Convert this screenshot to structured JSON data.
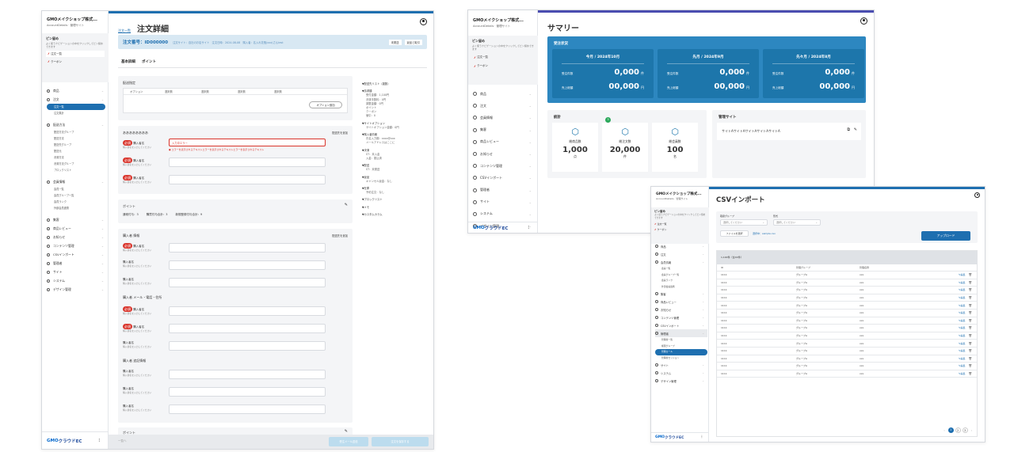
{
  "shared": {
    "brand": "GMOメイクショップ株式...",
    "account": "AccountDetails · 管理サイト",
    "pin_title": "ピン留め",
    "pin_desc": "よく使うナビゲーションの中をクリックしてピン留めできます",
    "pinned": [
      "注文一覧",
      "クーポン"
    ],
    "gmo_logo": "GMO",
    "gmo_logo_rest": "クラウドEC"
  },
  "win1": {
    "breadcrumb": "注文一覧",
    "title": "注文詳細",
    "order_bar": {
      "number": "注文番号：ID000000",
      "meta": "注文サイト：自社のお店サイト　注文日時：2024-08-08　購入者：名入れ花瓶(xxx)さんtest",
      "badges": [
        "未発送",
        "返品と取引"
      ]
    },
    "tabs": [
      "基本詳細",
      "ポイント"
    ],
    "nav": [
      {
        "label": "商品",
        "subs": []
      },
      {
        "label": "注文",
        "subs": [
          "注文一覧",
          "注文集計"
        ]
      },
      {
        "label": "配送方法",
        "subs": [
          "配送方法グループ",
          "配送方法",
          "配送先グループ"
        ]
      },
      {
        "label": "",
        "subs": [
          "配送元",
          "決済方法",
          "決済方法グループ",
          "ブロックリスト"
        ]
      },
      {
        "label": "会員情報",
        "subs": [
          "会員一覧",
          "会員グループ一覧",
          "会員ランク",
          "外部会員連携"
        ]
      },
      {
        "label": "集客",
        "subs": []
      },
      {
        "label": "商品レビュー",
        "subs": []
      },
      {
        "label": "お知らせ",
        "subs": []
      },
      {
        "label": "コンテンツ管理",
        "subs": []
      },
      {
        "label": "CSVインポート",
        "subs": []
      },
      {
        "label": "管理者",
        "subs": []
      },
      {
        "label": "サイト",
        "subs": []
      },
      {
        "label": "システム",
        "subs": []
      },
      {
        "label": "デザイン管理",
        "subs": []
      }
    ],
    "option_section": {
      "title": "配送指定",
      "col_headers": [
        "オプション",
        "選択肢",
        "選択肢",
        "選択肢",
        "選択肢"
      ],
      "button": "オプション追加"
    },
    "purchaser_section": {
      "title": "ああああああああ",
      "link": "配送先を追加",
      "field_label": "購入者名",
      "field_hint": "購入者名を入力してください",
      "error_value": "入力中エラー",
      "error_msg": "エラーを表示されるテキストエラーを表示されるテキストエラーを表示されるテキスト"
    },
    "point_section": {
      "title": "ポイント",
      "items": [
        "通常付与：3",
        "購買付与合計：3",
        "新規登録付与合計：9"
      ]
    },
    "addr_section": {
      "title": "購入者 情報",
      "link": "配送先を追加",
      "sub_title": "購入者 メール・電話・住所",
      "sub_title2": "購入者 追記情報"
    },
    "point_footer": "ポイント",
    "side_notes": [
      "▼配送先リスト（複数）",
      "▼請求額",
      "受付金額：1,100円",
      "決済手数料：0円",
      "調整金額：0円",
      "ポイント",
      "クーポン",
      "値引：0",
      "▼サイトオプション",
      "サイトオプション金額：0円",
      "▼購入者情報",
      "氏名入力欄：xxxx@xxx",
      "メールアドレスはここに",
      "▼決済",
      "ST：未入金",
      "入金：振込済",
      "▼配送",
      "ST：未発送",
      "▼返品",
      "キャンセル返金：なし",
      "▼在庫",
      "予約注文：なし",
      "▼ブロックリスト",
      "▼メモ",
      "▼カスタムカラム"
    ],
    "footer_buttons": [
      "一覧へ",
      "受注メール送信",
      "注文を保存する"
    ]
  },
  "win2": {
    "title": "サマリー",
    "status_title": "受注状況",
    "months": [
      {
        "label": "今月 / 2024年10月",
        "orders_label": "受注件数",
        "orders": "0,000",
        "orders_unit": "件",
        "sales_label": "売上総額",
        "sales": "00,000",
        "sales_unit": "円"
      },
      {
        "label": "先月 / 2024年9月",
        "orders_label": "受注件数",
        "orders": "0,000",
        "orders_unit": "件",
        "sales_label": "売上総額",
        "sales": "00,000",
        "sales_unit": "円"
      },
      {
        "label": "先々月 / 2024年8月",
        "orders_label": "受注件数",
        "orders": "0,000",
        "orders_unit": "件",
        "sales_label": "売上総額",
        "sales": "00,000",
        "sales_unit": "円"
      }
    ],
    "stats_title": "統計",
    "stats_badge": "3",
    "stats": [
      {
        "label": "総商品数",
        "value": "1,000",
        "unit": "点"
      },
      {
        "label": "総注文数",
        "value": "20,000",
        "unit": "件"
      },
      {
        "label": "総会員数",
        "value": "100",
        "unit": "名"
      }
    ],
    "admin_title": "管理サイト",
    "admin_site": "サイトAサイトAサイトAサイトAサイトA",
    "nav": [
      "商品",
      "注文",
      "会員情報",
      "集客",
      "商品レビュー",
      "お知らせ",
      "コンテンツ管理",
      "CSVインポート",
      "管理者",
      "サイト",
      "システム",
      "デザイン管理"
    ]
  },
  "win3": {
    "title": "CSVインポート",
    "filter_labels": [
      "取扱グループ",
      "形式"
    ],
    "select_placeholder": "選択してください",
    "file_button": "ファイルを選択",
    "file_name": "選択中：sample.csv",
    "upload_button": "アップロード",
    "list_title": "1,100件（全XX件）",
    "columns": [
      "ID",
      "管理グループ",
      "管理名称"
    ],
    "rows": [
      [
        "1111",
        "グループA",
        "xxx"
      ],
      [
        "1111",
        "グループA",
        "xxx"
      ],
      [
        "1111",
        "グループA",
        "xxx"
      ],
      [
        "1111",
        "グループA",
        "xxx"
      ],
      [
        "1111",
        "グループA",
        "xxx"
      ],
      [
        "1111",
        "グループA",
        "xxx"
      ],
      [
        "1111",
        "グループA",
        "xxx"
      ],
      [
        "1111",
        "グループA",
        "xxx"
      ],
      [
        "1111",
        "グループA",
        "xxx"
      ],
      [
        "1111",
        "グループA",
        "xxx"
      ],
      [
        "1111",
        "グループA",
        "xxx"
      ],
      [
        "1111",
        "グループA",
        "xxx"
      ],
      [
        "1111",
        "グループA",
        "xxx"
      ],
      [
        "1111",
        "グループA",
        "xxx"
      ]
    ],
    "row_action": "編集",
    "pages": [
      "1",
      "2",
      "3"
    ],
    "nav": [
      {
        "label": "商品",
        "subs": []
      },
      {
        "label": "注文",
        "subs": []
      },
      {
        "label": "会員情報",
        "subs": [
          "会員一覧",
          "会員グループ一覧",
          "会員ランク",
          "外部会員連携"
        ]
      },
      {
        "label": "集客",
        "subs": []
      },
      {
        "label": "商品レビュー",
        "subs": []
      },
      {
        "label": "お知らせ",
        "subs": []
      },
      {
        "label": "コンテンツ管理",
        "subs": []
      },
      {
        "label": "CSVインポート",
        "subs": []
      },
      {
        "label": "管理者",
        "subs": [
          "管理者一覧",
          "権限グループ",
          "管理ロール",
          "管理者セッション"
        ]
      },
      {
        "label": "サイト",
        "subs": []
      },
      {
        "label": "システム",
        "subs": []
      },
      {
        "label": "デザイン管理",
        "subs": []
      }
    ]
  }
}
